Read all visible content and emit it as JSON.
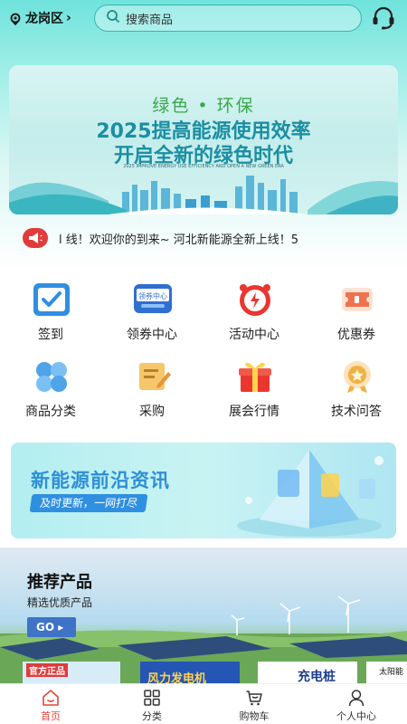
{
  "header": {
    "location": "龙岗区",
    "search_placeholder": "搜索商品"
  },
  "banner": {
    "line1": "绿色 • 环保",
    "line2": "2025提高能源使用效率",
    "line3": "开启全新的绿色时代",
    "small_text": "2025 IMPROVE ENERGY USE EFFICIENCY AND OPEN A NEW GREEN ERA"
  },
  "notice": {
    "text": "l 线！欢迎你的到来~        河北新能源全新上线！5"
  },
  "grid": {
    "items": [
      {
        "label": "签到",
        "icon": "check-calendar-icon"
      },
      {
        "label": "领券中心",
        "icon": "coupon-center-icon",
        "icon_text": "领券中心"
      },
      {
        "label": "活动中心",
        "icon": "alarm-clock-icon"
      },
      {
        "label": "优惠券",
        "icon": "ticket-icon"
      },
      {
        "label": "商品分类",
        "icon": "category-icon"
      },
      {
        "label": "采购",
        "icon": "purchase-note-icon"
      },
      {
        "label": "展会行情",
        "icon": "gift-box-icon"
      },
      {
        "label": "技术问答",
        "icon": "medal-icon"
      }
    ]
  },
  "promo": {
    "title": "新能源前沿资讯",
    "pill": "及时更新，一网打尽"
  },
  "recommend": {
    "title": "推荐产品",
    "subtitle": "精选优质产品",
    "go": "GO",
    "products": [
      {
        "tag": "官方正品"
      },
      {
        "tag": "风力发电机"
      },
      {
        "tag": "充电桩"
      },
      {
        "tag": "太阳能"
      }
    ]
  },
  "tabbar": {
    "tabs": [
      {
        "label": "首页",
        "icon": "home-icon",
        "active": true
      },
      {
        "label": "分类",
        "icon": "grid-icon",
        "active": false
      },
      {
        "label": "购物车",
        "icon": "cart-icon",
        "active": false
      },
      {
        "label": "个人中心",
        "icon": "user-icon",
        "active": false
      }
    ]
  },
  "colors": {
    "accent": "#e2453c",
    "teal": "#37b7ae",
    "brand_blue": "#2f8fe0"
  }
}
